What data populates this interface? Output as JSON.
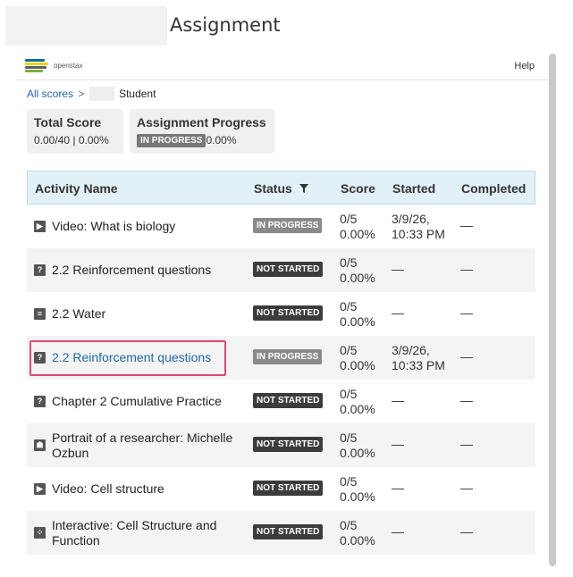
{
  "page": {
    "title": "Assignment"
  },
  "topbar": {
    "brand": "openstax",
    "help_label": "Help"
  },
  "colors": {
    "logo_stripes": [
      "#0f6f8a",
      "#f4d019",
      "#5e6062",
      "#77af42"
    ]
  },
  "breadcrumb": {
    "link_label": "All scores",
    "separator": ">",
    "current": "Student"
  },
  "total_score": {
    "title": "Total Score",
    "value": "0.00/40 | 0.00%"
  },
  "assignment_progress": {
    "title": "Assignment Progress",
    "badge": "IN PROGRESS",
    "value": "0.00%"
  },
  "table": {
    "headers": {
      "name": "Activity Name",
      "status": "Status",
      "filter_icon": "filter-icon",
      "score": "Score",
      "started": "Started",
      "completed": "Completed"
    },
    "rows": [
      {
        "icon": "video-icon",
        "glyph": "▶",
        "name": "Video: What is biology",
        "status": "IN PROGRESS",
        "status_kind": "inprogress",
        "score_line1": "0/5",
        "score_line2": "0.00%",
        "started_line1": "3/9/26,",
        "started_line2": "10:33 PM",
        "completed": "—"
      },
      {
        "icon": "question-icon",
        "glyph": "?",
        "name": "2.2 Reinforcement questions",
        "status": "NOT STARTED",
        "status_kind": "notstarted",
        "score_line1": "0/5",
        "score_line2": "0.00%",
        "started_line1": "—",
        "started_line2": "",
        "completed": "—"
      },
      {
        "icon": "reading-icon",
        "glyph": "≡",
        "name": "2.2 Water",
        "status": "NOT STARTED",
        "status_kind": "notstarted",
        "score_line1": "0/5",
        "score_line2": "0.00%",
        "started_line1": "—",
        "started_line2": "",
        "completed": "—"
      },
      {
        "icon": "question-icon",
        "glyph": "?",
        "name": "2.2 Reinforcement questions",
        "status": "IN PROGRESS",
        "status_kind": "inprogress",
        "score_line1": "0/5",
        "score_line2": "0.00%",
        "started_line1": "3/9/26,",
        "started_line2": "10:33 PM",
        "completed": "—",
        "is_link": true,
        "highlighted": true
      },
      {
        "icon": "question-icon",
        "glyph": "?",
        "name": "Chapter 2 Cumulative Practice",
        "status": "NOT STARTED",
        "status_kind": "notstarted",
        "score_line1": "0/5",
        "score_line2": "0.00%",
        "started_line1": "—",
        "started_line2": "",
        "completed": "—"
      },
      {
        "icon": "person-icon",
        "glyph": "☗",
        "name": "Portrait of a researcher: Michelle Ozbun",
        "status": "NOT STARTED",
        "status_kind": "notstarted",
        "score_line1": "0/5",
        "score_line2": "0.00%",
        "started_line1": "—",
        "started_line2": "",
        "completed": "—"
      },
      {
        "icon": "video-icon",
        "glyph": "▶",
        "name": "Video: Cell structure",
        "status": "NOT STARTED",
        "status_kind": "notstarted",
        "score_line1": "0/5",
        "score_line2": "0.00%",
        "started_line1": "—",
        "started_line2": "",
        "completed": "—"
      },
      {
        "icon": "interactive-icon",
        "glyph": "⁘",
        "name": "Interactive: Cell Structure and Function",
        "status": "NOT STARTED",
        "status_kind": "notstarted",
        "score_line1": "0/5",
        "score_line2": "0.00%",
        "started_line1": "—",
        "started_line2": "",
        "completed": "—"
      }
    ]
  }
}
